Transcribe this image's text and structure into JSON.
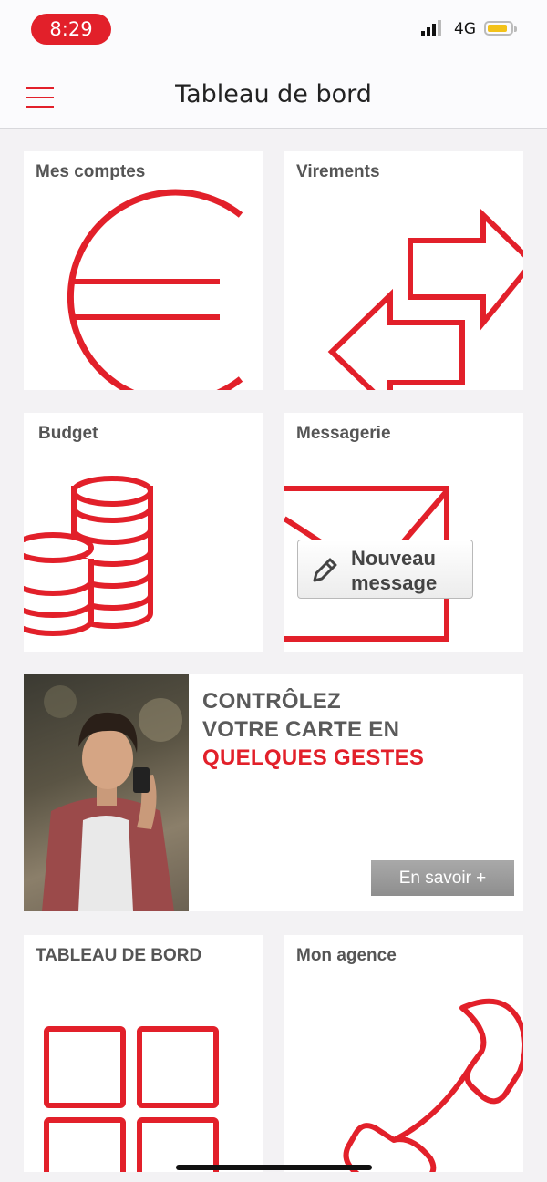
{
  "status_bar": {
    "time": "8:29",
    "network": "4G"
  },
  "header": {
    "title": "Tableau de bord",
    "menu_icon": "hamburger-menu-icon"
  },
  "tiles": {
    "comptes": {
      "label": "Mes comptes",
      "icon": "euro-icon"
    },
    "virements": {
      "label": "Virements",
      "icon": "transfer-arrows-icon"
    },
    "budget": {
      "label": "Budget",
      "icon": "coins-stack-icon"
    },
    "messagerie": {
      "label": "Messagerie",
      "icon": "envelope-icon",
      "new_message_line1": "Nouveau",
      "new_message_line2": "message"
    },
    "tableau": {
      "label": "TABLEAU DE BORD",
      "icon": "grid-icon"
    },
    "agence": {
      "label": "Mon agence",
      "icon": "phone-icon"
    }
  },
  "promo": {
    "line1": "CONTRÔLEZ",
    "line2": "VOTRE CARTE EN",
    "line3": "QUELQUES GESTES",
    "cta": "En savoir +"
  },
  "colors": {
    "accent": "#e2202a",
    "tile_label": "#555555",
    "background": "#f3f2f4"
  }
}
